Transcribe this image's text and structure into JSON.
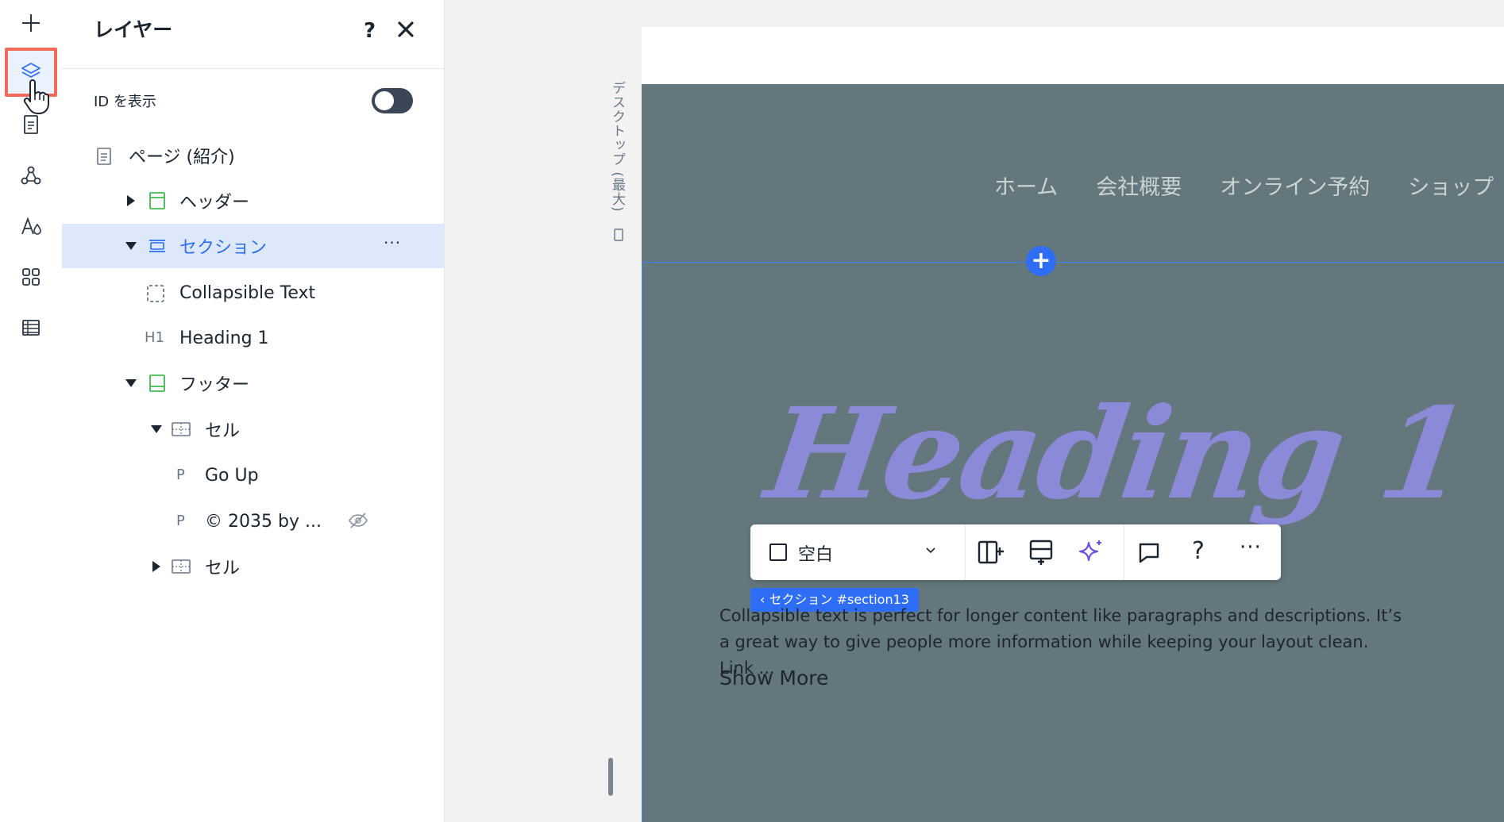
{
  "rail": {
    "items": [
      "add-icon",
      "layers-icon",
      "pages-icon",
      "connections-icon",
      "theme-icon",
      "apps-icon",
      "table-icon"
    ],
    "active": "layers-icon"
  },
  "panel": {
    "title": "レイヤー",
    "help": "?",
    "show_id_label": "ID を表示",
    "toggle_on": false,
    "tree": [
      {
        "label": "ページ (紹介)",
        "icon": "page-icon"
      },
      {
        "label": "ヘッダー",
        "icon": "header-icon",
        "expanded": false
      },
      {
        "label": "セクション",
        "icon": "section-icon",
        "expanded": true,
        "selected": true,
        "more": "···"
      },
      {
        "label": "Collapsible Text",
        "icon": "collapsible-icon"
      },
      {
        "label": "Heading 1",
        "icon_text": "H1"
      },
      {
        "label": "フッター",
        "icon": "footer-icon",
        "expanded": true
      },
      {
        "label": "セル",
        "icon": "cell-icon",
        "expanded": true
      },
      {
        "label": "Go Up",
        "icon_text": "P"
      },
      {
        "label": "© 2035 by ...",
        "icon_text": "P",
        "hidden": true
      },
      {
        "label": "セル",
        "icon": "cell-icon",
        "expanded": false
      }
    ]
  },
  "canvas": {
    "breakpoint_label": "デスクトップ (最大)",
    "nav": [
      "ホーム",
      "会社概要",
      "オンライン予約",
      "ショップ"
    ],
    "heading": "Heading 1",
    "toolbar": {
      "background_label": "空白",
      "help": "?",
      "more": "···"
    },
    "section_tag": "‹ セクション #section13",
    "body_text": "Collapsible text is perfect for longer content like paragraphs and descriptions. It’s a great way to give people more information while keeping your layout clean. Link ...",
    "show_more": "Show More"
  },
  "colors": {
    "accent": "#2e6df6",
    "site_bg": "#63777c",
    "heading": "#8b8ad8",
    "highlight": "#f26a5a",
    "selected_row": "#dde8fb"
  }
}
